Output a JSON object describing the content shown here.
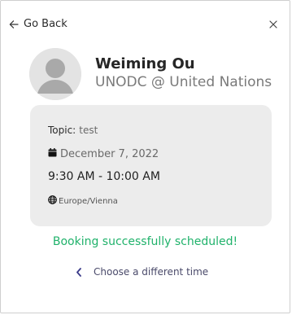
{
  "header": {
    "back_label": "Go Back"
  },
  "profile": {
    "name": "Weiming Ou",
    "organization": "UNODC @ United Nations"
  },
  "booking": {
    "topic_label": "Topic:",
    "topic_value": "test",
    "date": "December 7, 2022",
    "time_range": "9:30 AM - 10:00 AM",
    "timezone": "Europe/Vienna"
  },
  "status": {
    "message": "Booking successfully scheduled!",
    "color": "#20b26b"
  },
  "actions": {
    "change_time_label": "Choose a different time"
  },
  "icons": {
    "back": "arrow-left-icon",
    "close": "close-icon",
    "calendar": "calendar-icon",
    "globe": "globe-icon",
    "chevron": "chevron-left-icon"
  }
}
